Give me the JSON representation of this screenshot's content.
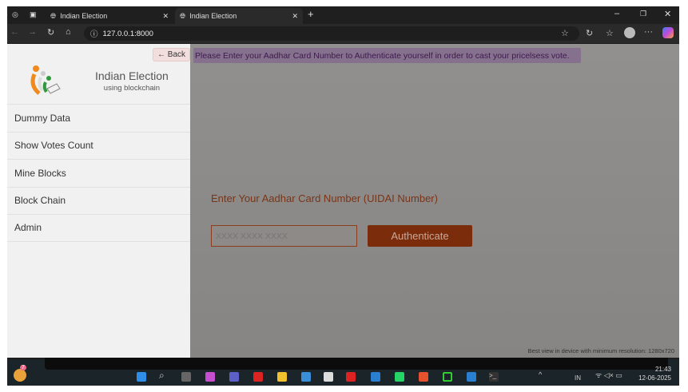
{
  "browser": {
    "tabs": [
      {
        "title": "Indian Election"
      },
      {
        "title": "Indian Election"
      }
    ],
    "url": "127.0.0.1:8000",
    "window_controls": [
      "minimize",
      "restore",
      "close"
    ]
  },
  "sidebar": {
    "back_label": "← Back",
    "brand_title": "Indian Election",
    "brand_subtitle": "using blockchain",
    "items": [
      {
        "label": "Dummy Data"
      },
      {
        "label": "Show Votes Count"
      },
      {
        "label": "Mine Blocks"
      },
      {
        "label": "Block Chain"
      },
      {
        "label": "Admin"
      }
    ]
  },
  "main": {
    "notice": "Please Enter your Aadhar Card Number to Authenticate yourself in order to cast your pricelsess vote.",
    "label": "Enter Your Aadhar Card Number (UIDAI Number)",
    "input_placeholder": "XXXX XXXX XXXX",
    "button_label": "Authenticate",
    "footer_note": "Best view in device with minimum resolution: 1280x720"
  },
  "taskbar": {
    "language": "IN",
    "time": "21:43",
    "date": "12-06-2025",
    "notification_count": "7"
  },
  "colors": {
    "accent": "#7b2c0a",
    "notice_bg": "#85708d",
    "sidebar_bg": "#f1f1f1"
  }
}
